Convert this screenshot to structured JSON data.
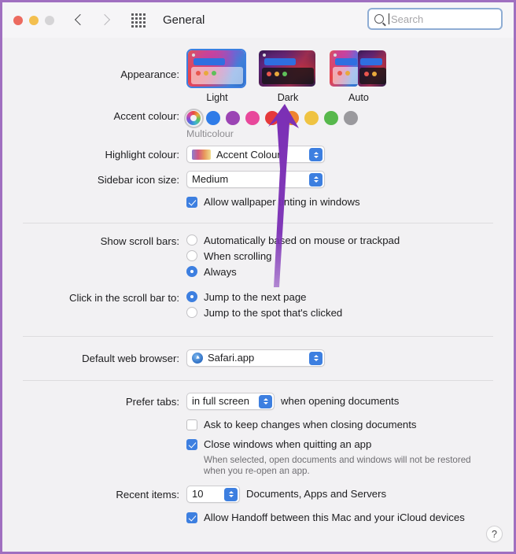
{
  "window": {
    "title": "General",
    "traffic_lights": [
      "close",
      "minimize",
      "zoom"
    ],
    "back_label": "Back",
    "forward_label": "Forward",
    "grid_label": "Show All",
    "search": {
      "placeholder": "Search",
      "value": ""
    }
  },
  "appearance": {
    "label": "Appearance:",
    "options": [
      {
        "name": "Light",
        "selected": true
      },
      {
        "name": "Dark",
        "selected": false
      },
      {
        "name": "Auto",
        "selected": false
      }
    ]
  },
  "accent": {
    "label": "Accent colour:",
    "caption": "Multicolour",
    "swatches": [
      {
        "name": "Multicolour",
        "color": "multicolour",
        "selected": true
      },
      {
        "name": "Blue",
        "color": "#2f7ce8",
        "selected": false
      },
      {
        "name": "Purple",
        "color": "#9b44b4",
        "selected": false
      },
      {
        "name": "Pink",
        "color": "#e8489b",
        "selected": false
      },
      {
        "name": "Red",
        "color": "#e5393b",
        "selected": false
      },
      {
        "name": "Orange",
        "color": "#ef8430",
        "selected": false
      },
      {
        "name": "Yellow",
        "color": "#efc342",
        "selected": false
      },
      {
        "name": "Green",
        "color": "#4eb košuly",
        "selected": false
      },
      {
        "name": "Graphite",
        "color": "#9a999d",
        "selected": false
      }
    ]
  },
  "highlight": {
    "label": "Highlight colour:",
    "value": "Accent Colour"
  },
  "sidebar_icon": {
    "label": "Sidebar icon size:",
    "value": "Medium"
  },
  "wallpaper_tinting": {
    "label": "Allow wallpaper tinting in windows",
    "checked": true
  },
  "scroll_bars": {
    "label": "Show scroll bars:",
    "options": [
      {
        "label": "Automatically based on mouse or trackpad",
        "selected": false
      },
      {
        "label": "When scrolling",
        "selected": false
      },
      {
        "label": "Always",
        "selected": true
      }
    ]
  },
  "click_scroll": {
    "label": "Click in the scroll bar to:",
    "options": [
      {
        "label": "Jump to the next page",
        "selected": true
      },
      {
        "label": "Jump to the spot that's clicked",
        "selected": false
      }
    ]
  },
  "browser": {
    "label": "Default web browser:",
    "value": "Safari.app"
  },
  "tabs": {
    "label": "Prefer tabs:",
    "value": "in full screen",
    "suffix": "when opening documents"
  },
  "ask_keep_changes": {
    "label": "Ask to keep changes when closing documents",
    "checked": false
  },
  "close_windows": {
    "label": "Close windows when quitting an app",
    "checked": true,
    "hint": "When selected, open documents and windows will not be restored when you re-open an app."
  },
  "recent_items": {
    "label": "Recent items:",
    "value": "10",
    "suffix": "Documents, Apps and Servers"
  },
  "handoff": {
    "label": "Allow Handoff between this Mac and your iCloud devices",
    "checked": true
  },
  "help": {
    "label": "?"
  },
  "annotation": {
    "type": "arrow",
    "points_to": "Dark",
    "color": "#7b2fb5"
  }
}
